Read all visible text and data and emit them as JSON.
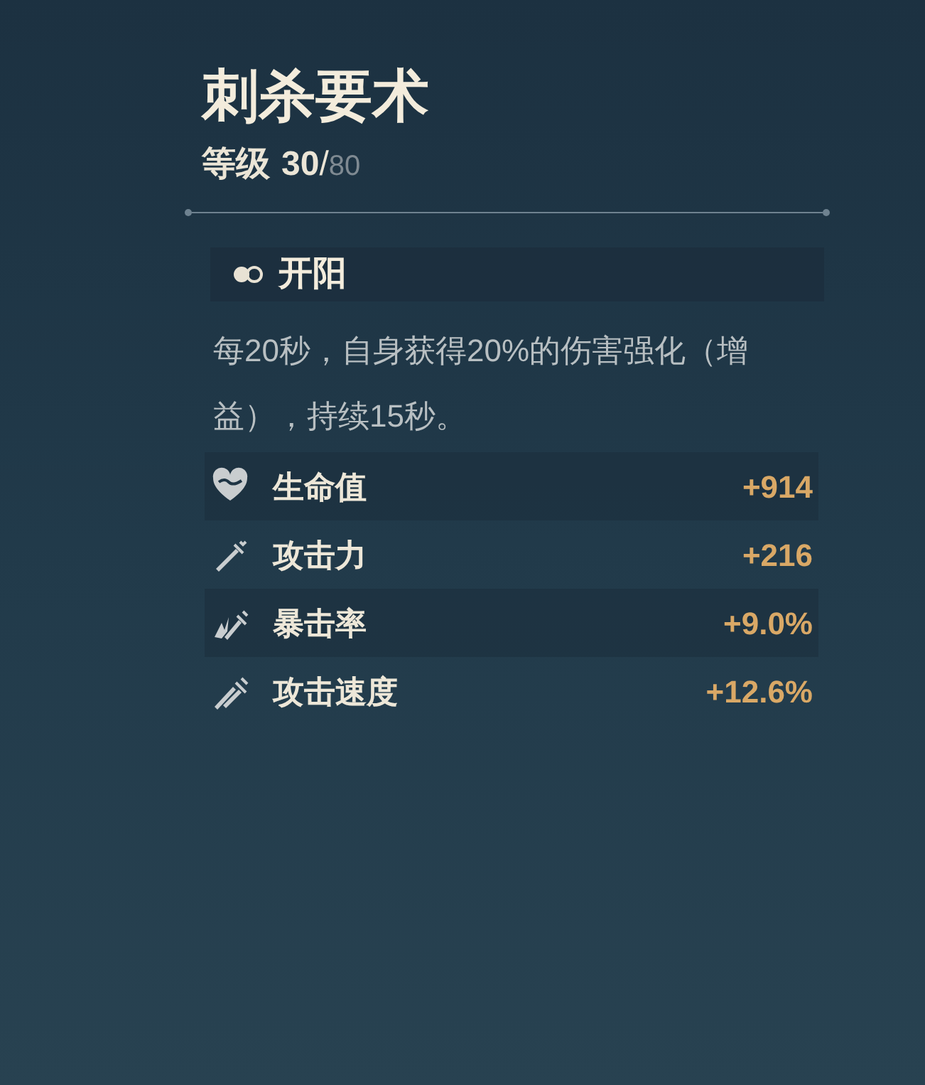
{
  "title": "刺杀要术",
  "level": {
    "label": "等级",
    "current": "30",
    "separator": "/",
    "max": "80"
  },
  "skill": {
    "name": "开阳",
    "description": "每20秒，自身获得20%的伤害强化（增益），持续15秒。"
  },
  "stats": [
    {
      "kind": "heart",
      "label": "生命值",
      "value": "+914"
    },
    {
      "kind": "sword",
      "label": "攻击力",
      "value": "+216"
    },
    {
      "kind": "crit",
      "label": "暴击率",
      "value": "+9.0%"
    },
    {
      "kind": "speed",
      "label": "攻击速度",
      "value": "+12.6%"
    }
  ]
}
